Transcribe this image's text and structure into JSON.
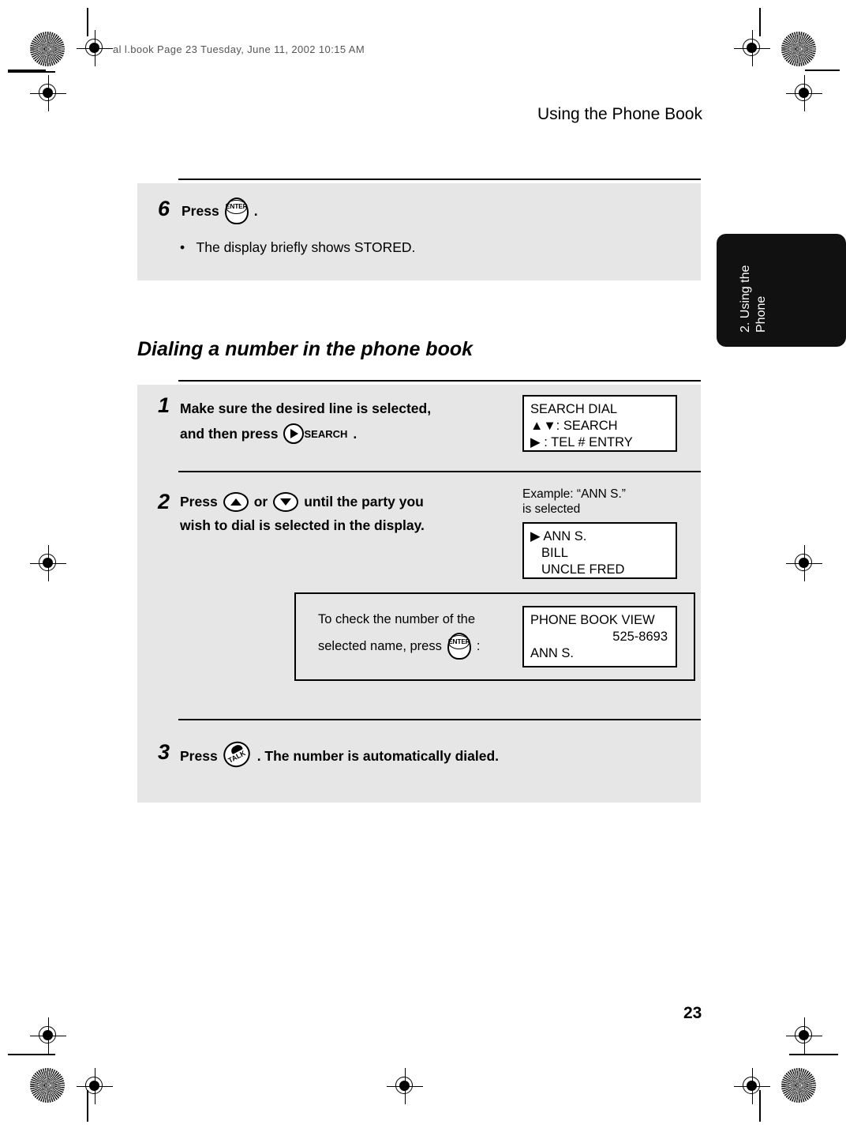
{
  "print_marks": {
    "doc_code": "al l.book  Page 23  Tuesday, June 11, 2002  10:15 AM"
  },
  "header": {
    "running_head": "Using the Phone Book"
  },
  "chapter_tab": {
    "label": "2. Using the\nPhone",
    "line1": "2. Using the",
    "line2": "Phone",
    "bg_color": "#111111",
    "text_color": "#ffffff"
  },
  "blocks": {
    "step6": {
      "number": "6",
      "text_before": "Press",
      "key": "enter-key",
      "key_label": "ENTER",
      "text_after": ".",
      "bullet": "The display briefly shows STORED.",
      "bullet_marker": "•"
    },
    "section": {
      "title": "Dialing a number in the phone book"
    },
    "step1": {
      "number": "1",
      "line1": "Make sure the desired line is selected,",
      "line2_before": "and then press",
      "key": "search-key",
      "key_label": "SEARCH",
      "line2_after": ".",
      "lcd": {
        "line1": "SEARCH DIAL",
        "line2": "▲▼: SEARCH",
        "line3": "▶ : TEL # ENTRY"
      }
    },
    "step2": {
      "number": "2",
      "line1_before": "Press",
      "key_up": "up-arrow-key",
      "or_text": "or",
      "key_down": "down-arrow-key",
      "line1_after": "until the party you",
      "line2": "wish to dial is selected in the display.",
      "example_label_line1": "Example: “ANN S.”",
      "example_label_line2": "is selected",
      "lcd": {
        "line1": "▶ ANN S.",
        "line2": "BILL",
        "line3": "UNCLE FRED"
      },
      "note": {
        "line1": "To check the number of the",
        "line2_before": "selected name, press",
        "key": "enter-key",
        "key_label": "ENTER",
        "line2_after": ":",
        "lcd": {
          "line1": "PHONE BOOK VIEW",
          "line2": "525-8693",
          "line3": "ANN S."
        }
      }
    },
    "step3": {
      "number": "3",
      "text_before": "Press",
      "key": "talk-key",
      "key_label": "TALK",
      "text_after": ". The number is automatically dialed."
    }
  },
  "footer": {
    "page_number": "23"
  }
}
